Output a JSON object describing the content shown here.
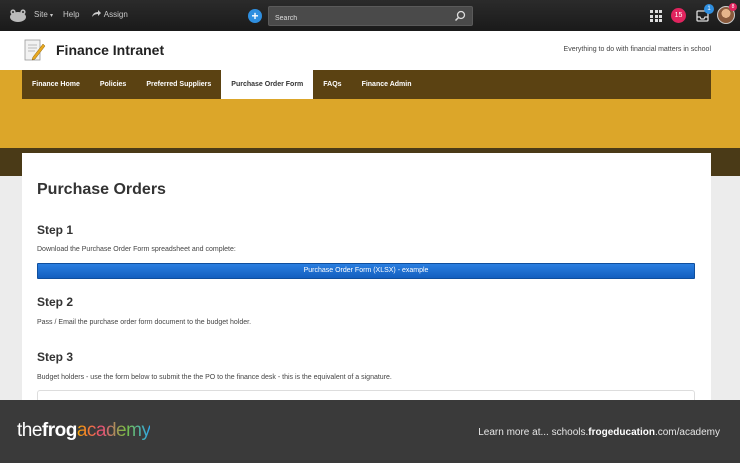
{
  "topbar": {
    "site_label": "Site",
    "site_caret": "▾",
    "help_label": "Help",
    "assign_label": "Assign",
    "search_placeholder": "Search",
    "notification_count": "15",
    "inbox_count": "1",
    "avatar_count": "8"
  },
  "header": {
    "title": "Finance Intranet",
    "tagline": "Everything to do with financial matters in school"
  },
  "nav": {
    "items": [
      {
        "label": "Finance Home"
      },
      {
        "label": "Policies"
      },
      {
        "label": "Preferred Suppliers"
      },
      {
        "label": "Purchase Order Form"
      },
      {
        "label": "FAQs"
      },
      {
        "label": "Finance Admin"
      }
    ],
    "active_index": 3
  },
  "content": {
    "page_title": "Purchase Orders",
    "steps": [
      {
        "title": "Step 1",
        "text": "Download the Purchase Order Form spreadsheet and complete:"
      },
      {
        "title": "Step 2",
        "text": "Pass / Email the purchase order form document to the budget holder."
      },
      {
        "title": "Step 3",
        "text": "Budget holders - use the form below to submit the the PO to the finance desk - this is the equivalent of a signature."
      }
    ],
    "download_button": "Purchase Order Form (XLSX) - example"
  },
  "footer": {
    "brand_the": "the",
    "brand_frog": "frog",
    "brand_academy": "academy",
    "learn_prefix": "Learn more at... schools.",
    "learn_bold": "frogeducation",
    "learn_suffix": ".com/academy"
  },
  "colors": {
    "accent_yellow": "#dca629",
    "nav_brown": "#5b4212",
    "button_blue": "#1a6fd4"
  }
}
